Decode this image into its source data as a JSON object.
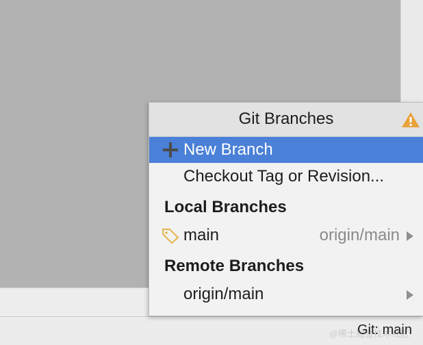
{
  "popup": {
    "title": "Git Branches",
    "actions": [
      {
        "label": "New Branch",
        "icon": "plus-icon"
      },
      {
        "label": "Checkout Tag or Revision..."
      }
    ],
    "local_header": "Local Branches",
    "local_branches": [
      {
        "name": "main",
        "tracking": "origin/main",
        "icon": "tag-icon"
      }
    ],
    "remote_header": "Remote Branches",
    "remote_branches": [
      {
        "name": "origin/main"
      }
    ],
    "warning_icon": "warning-icon"
  },
  "status_bar": {
    "git_branch": "Git: main",
    "watermark": "@稀土掘金技术社区"
  },
  "colors": {
    "selection": "#4a80d7",
    "warning": "#e8a33c",
    "tag": "#e3b44e",
    "editor_bg": "#b2b2b2"
  }
}
